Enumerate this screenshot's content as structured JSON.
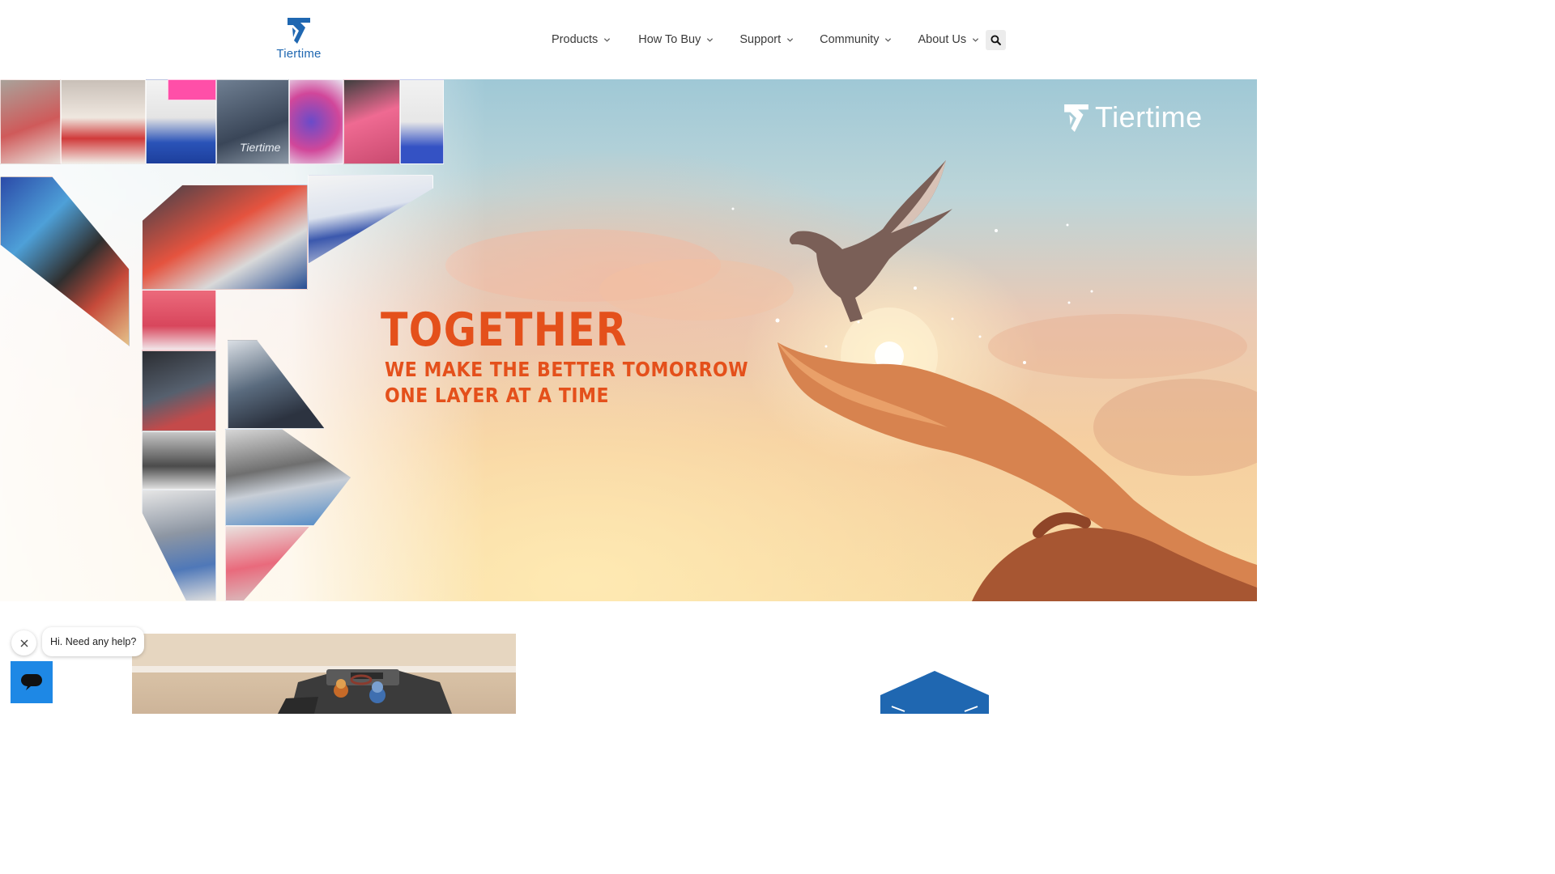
{
  "header": {
    "logo_text": "Tiertime",
    "nav": [
      {
        "label": "Products"
      },
      {
        "label": "How To Buy"
      },
      {
        "label": "Support"
      },
      {
        "label": "Community"
      },
      {
        "label": "About Us"
      }
    ],
    "search_icon": "search-icon"
  },
  "hero": {
    "brand_text": "Tiertime",
    "headline": "TOGETHER",
    "subline_1": "WE MAKE THE BETTER TOMORROW",
    "subline_2": "ONE LAYER AT A TIME",
    "collage_watermark": "Tiertime"
  },
  "chat": {
    "greeting": "Hi. Need any help?",
    "close_icon": "close-icon",
    "launcher_icon": "chat-icon"
  },
  "colors": {
    "brand_blue": "#1f67b1",
    "headline_orange": "#e4501b",
    "chat_blue": "#1e88e5"
  }
}
